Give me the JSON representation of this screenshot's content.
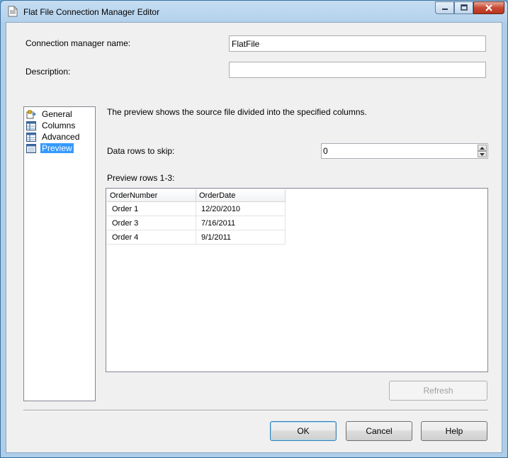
{
  "window": {
    "title": "Flat File Connection Manager Editor"
  },
  "form": {
    "connection_name_label": "Connection manager name:",
    "connection_name_value": "FlatFile",
    "description_label": "Description:",
    "description_value": ""
  },
  "nav": {
    "items": [
      {
        "label": "General",
        "icon": "general-icon"
      },
      {
        "label": "Columns",
        "icon": "columns-icon"
      },
      {
        "label": "Advanced",
        "icon": "advanced-icon"
      },
      {
        "label": "Preview",
        "icon": "preview-icon"
      }
    ],
    "selected": "Preview"
  },
  "preview": {
    "info_text": "The preview shows the source file divided into the specified columns.",
    "skip_label": "Data rows to skip:",
    "skip_value": "0",
    "rows_label": "Preview rows 1-3:",
    "columns": [
      "OrderNumber",
      "OrderDate"
    ],
    "rows": [
      [
        "Order 1",
        "12/20/2010"
      ],
      [
        "Order 3",
        "7/16/2011"
      ],
      [
        "Order 4",
        "9/1/2011"
      ]
    ],
    "refresh_label": "Refresh"
  },
  "buttons": {
    "ok": "OK",
    "cancel": "Cancel",
    "help": "Help"
  }
}
